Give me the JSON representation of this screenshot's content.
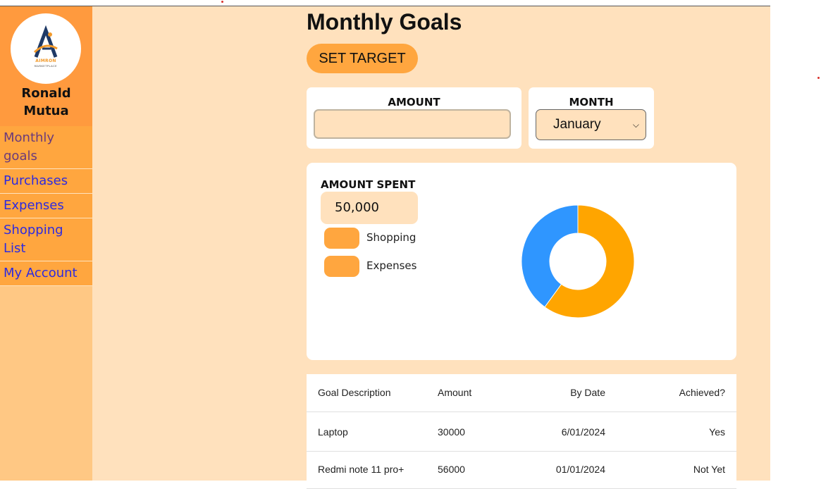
{
  "user": {
    "name": "Ronald Mutua",
    "logo": {
      "brand": "AIMRON",
      "subtitle": "MARKETPLACE"
    }
  },
  "nav": {
    "items": [
      {
        "label": "Monthly goals"
      },
      {
        "label": "Purchases"
      },
      {
        "label": "Expenses"
      },
      {
        "label": "Shopping List"
      },
      {
        "label": "My Account"
      }
    ]
  },
  "page": {
    "title": "Monthly Goals",
    "set_target_label": "SET TARGET"
  },
  "form": {
    "amount_label": "AMOUNT",
    "amount_value": "",
    "month_label": "MONTH",
    "month_selected": "January"
  },
  "summary": {
    "spent_label": "AMOUNT SPENT",
    "spent_value": "50,000",
    "legend": [
      {
        "label": "Shopping",
        "color": "#ffa63f"
      },
      {
        "label": "Expenses",
        "color": "#ffa63f"
      }
    ]
  },
  "chart_data": {
    "type": "pie",
    "donut": true,
    "slices": [
      {
        "value": 60,
        "color": "#ffa500"
      },
      {
        "value": 40,
        "color": "#2f96ff"
      }
    ]
  },
  "table": {
    "columns": [
      "Goal Description",
      "Amount",
      "By Date",
      "Achieved?"
    ],
    "rows": [
      [
        "Laptop",
        "30000",
        "6/01/2024",
        "Yes"
      ],
      [
        "Redmi note 11 pro+",
        "56000",
        "01/01/2024",
        "Not Yet"
      ]
    ]
  },
  "colors": {
    "accent": "#ffa63f",
    "sidebar_header": "#ff9a3e",
    "background": "#ffe1bd",
    "link": "#2d2ae0"
  }
}
